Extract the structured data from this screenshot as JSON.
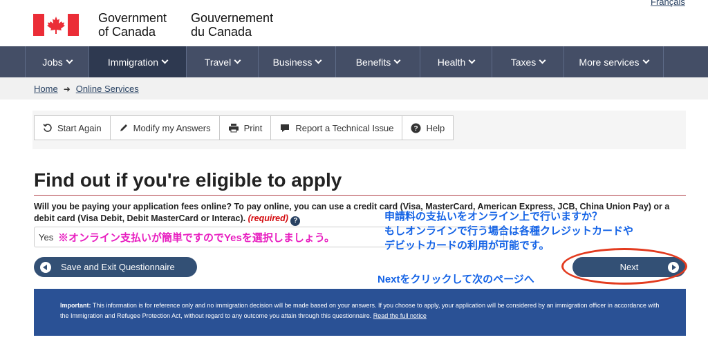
{
  "language_toggle": "Français",
  "header": {
    "signature_en": [
      "Government",
      "of Canada"
    ],
    "signature_fr": [
      "Gouvernement",
      "du Canada"
    ]
  },
  "nav": [
    {
      "label": "Jobs",
      "width": 93
    },
    {
      "label": "Immigration",
      "width": 141
    },
    {
      "label": "Travel",
      "width": 104
    },
    {
      "label": "Business",
      "width": 112
    },
    {
      "label": "Benefits",
      "width": 122
    },
    {
      "label": "Health",
      "width": 104
    },
    {
      "label": "Taxes",
      "width": 104
    },
    {
      "label": "More services",
      "width": 144
    }
  ],
  "breadcrumb": {
    "home": "Home",
    "current": "Online Services"
  },
  "toolbar": {
    "start_again": "Start Again",
    "modify": "Modify my Answers",
    "print": "Print",
    "report": "Report a Technical Issue",
    "help": "Help"
  },
  "page_title": "Find out if you're eligible to apply",
  "question": {
    "text": "Will you be paying your application fees online?  To pay online, you can use a credit card (Visa, MasterCard, American Express, JCB, China Union Pay) or a debit card (Visa Debit, Debit MasterCard or Interac).",
    "required": "(required)",
    "selected_value": "Yes"
  },
  "buttons": {
    "save_exit": "Save and Exit Questionnaire",
    "next": "Next"
  },
  "notice": {
    "important_label": "Important:",
    "text": " This information is for reference only and no immigration decision will be made based on your answers. If you choose to apply, your application will be considered by an immigration officer in accordance with the Immigration and Refugee Protection Act, without regard to any outcome you attain through this questionnaire. ",
    "link": "Read the full notice"
  },
  "annotations": {
    "jp_blue_line1": "申請料の支払いをオンライン上で行いますか？",
    "jp_blue_line2": "もしオンラインで行う場合は各種クレジットカードや",
    "jp_blue_line3": "デビットカードの利用が可能です。",
    "jp_pink": "※オンライン支払いが簡単ですのでYesを選択しましょう。",
    "jp_next": "Nextをクリックして次のページへ",
    "colors": {
      "blue": "#1463e6",
      "pink": "#e81fc0",
      "ellipse": "#e33b1f"
    }
  },
  "colors": {
    "nav_bg": "#444e66",
    "flag_red": "#eb2d37",
    "button_blue": "#335075",
    "notice_bg": "#2a5195"
  }
}
